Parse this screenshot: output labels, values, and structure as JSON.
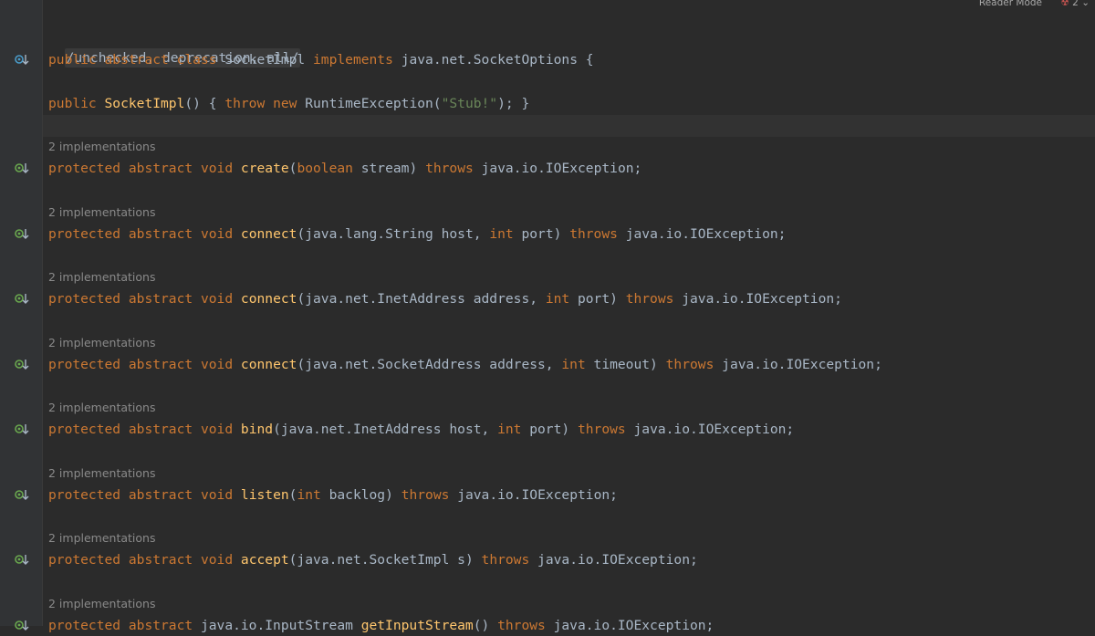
{
  "topbar": {
    "reader_mode": "Reader Mode",
    "problems_count": "2"
  },
  "hint_text": "2 implementations",
  "code": {
    "annotation": "/unchecked, deprecation, all/",
    "class_decl": {
      "kw1": "public",
      "kw2": "abstract",
      "kw3": "class",
      "name": "SocketImpl",
      "kw4": "implements",
      "iface": "java.net.SocketOptions {"
    },
    "ctor": {
      "kw1": "public",
      "name": "SocketImpl",
      "mid": "() { ",
      "kw2": "throw",
      "kw3": "new",
      "type": "RuntimeException(",
      "str": "\"Stub!\"",
      "end": "); }"
    },
    "methods": [
      {
        "name": "create",
        "before": "(",
        "args": [
          [
            "boolean",
            " stream"
          ]
        ],
        "after": ")",
        "throws_type": "java.io.IOException;"
      },
      {
        "name": "connect",
        "before": "(java.lang.String host, ",
        "args": [
          [
            "int",
            " port"
          ]
        ],
        "after": ")",
        "throws_type": "java.io.IOException;"
      },
      {
        "name": "connect",
        "before": "(java.net.InetAddress address, ",
        "args": [
          [
            "int",
            " port"
          ]
        ],
        "after": ")",
        "throws_type": "java.io.IOException;"
      },
      {
        "name": "connect",
        "before": "(java.net.SocketAddress address, ",
        "args": [
          [
            "int",
            " timeout"
          ]
        ],
        "after": ")",
        "throws_type": "java.io.IOException;"
      },
      {
        "name": "bind",
        "before": "(java.net.InetAddress host, ",
        "args": [
          [
            "int",
            " port"
          ]
        ],
        "after": ")",
        "throws_type": "java.io.IOException;"
      },
      {
        "name": "listen",
        "before": "(",
        "args": [
          [
            "int",
            " backlog"
          ]
        ],
        "after": ")",
        "throws_type": "java.io.IOException;"
      },
      {
        "name": "accept",
        "before": "(java.net.SocketImpl s",
        "args": [],
        "after": ")",
        "throws_type": "java.io.IOException;"
      }
    ],
    "last_method": {
      "kw1": "protected",
      "kw2": "abstract",
      "ret": "java.io.InputStream",
      "name": "getInputStream",
      "paren": "()",
      "throws": "throws",
      "throws_type": "java.io.IOException;"
    },
    "kw": {
      "protected": "protected",
      "abstract": "abstract",
      "void": "void",
      "throws": "throws"
    }
  },
  "colors": {
    "background": "#2b2b2b",
    "keyword": "#cc7832",
    "function": "#ffc66d",
    "string": "#6a8759",
    "text": "#a9b7c6",
    "gutter_icon": "#6aa84f"
  }
}
